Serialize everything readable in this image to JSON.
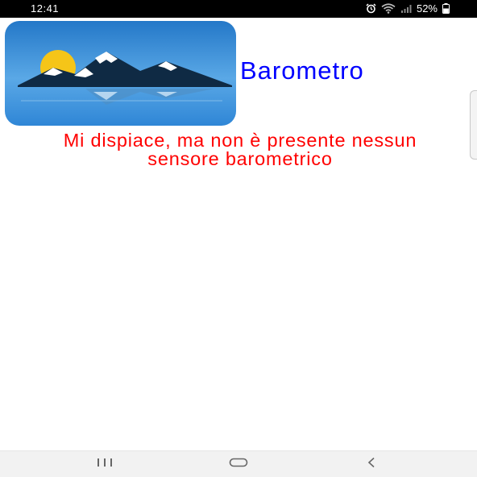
{
  "status_bar": {
    "time": "12:41",
    "battery_percent": "52%",
    "icons": [
      "alarm-icon",
      "wifi-icon",
      "signal-icon",
      "battery-icon"
    ]
  },
  "app": {
    "title": "Barometro",
    "message": "Mi dispiace, ma non è presente nessun sensore barometrico",
    "icon": "mountain-lake-sun-icon"
  },
  "nav_bar": {
    "buttons": [
      "recents-icon",
      "home-icon",
      "back-icon"
    ]
  },
  "colors": {
    "title": "#0000ff",
    "message": "#ff0000",
    "icon_sky_top": "#2a7fd0",
    "icon_sky_bottom": "#6fb3ea",
    "sun": "#f5c518"
  }
}
